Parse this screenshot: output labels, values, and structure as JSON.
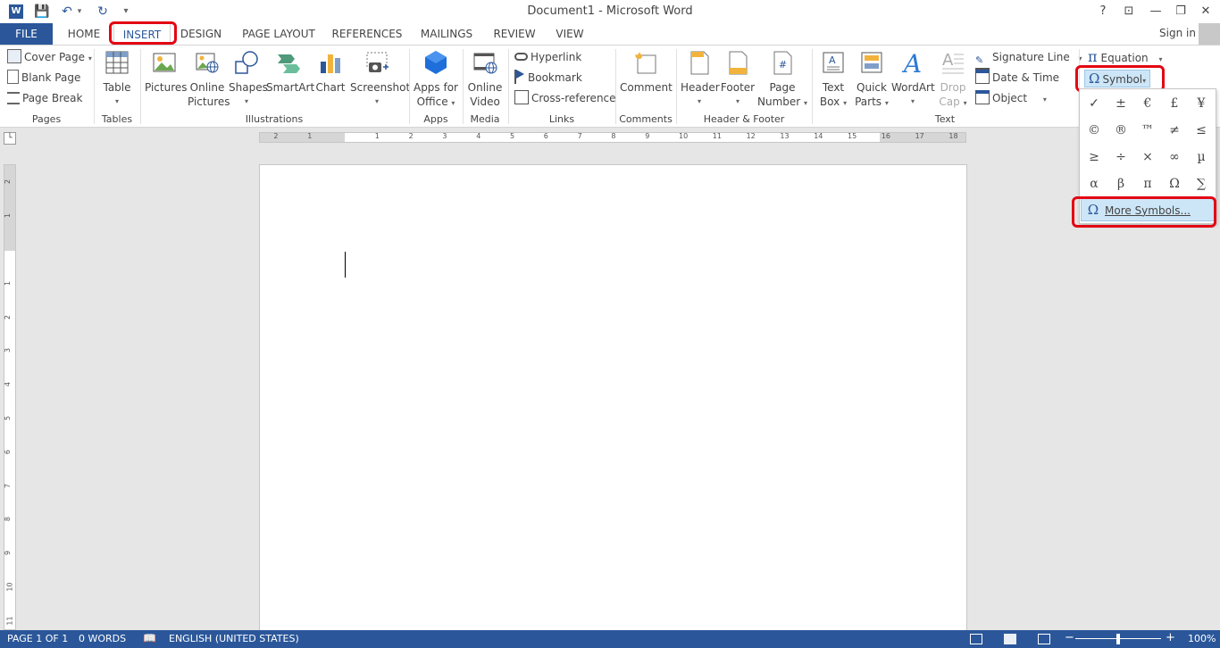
{
  "app": {
    "title": "Document1 - Microsoft Word",
    "icon_letter": "W",
    "accent": "#2b579a",
    "highlight": "#e30613"
  },
  "window_controls": {
    "help": "?",
    "ribbon_options": "⊡",
    "minimize": "—",
    "restore": "❐",
    "close": "✕"
  },
  "quick_access": {
    "save_icon": "💾",
    "undo_icon": "↶",
    "undo_dropdown": "▾",
    "redo_icon": "↻",
    "customize_icon": "▾"
  },
  "tabs": {
    "file": "FILE",
    "items": [
      "HOME",
      "INSERT",
      "DESIGN",
      "PAGE LAYOUT",
      "REFERENCES",
      "MAILINGS",
      "REVIEW",
      "VIEW"
    ],
    "active": "INSERT"
  },
  "account": {
    "sign_in": "Sign in"
  },
  "ribbon": {
    "pages": {
      "label": "Pages",
      "cover_page": "Cover Page",
      "blank_page": "Blank Page",
      "page_break": "Page Break"
    },
    "tables": {
      "label": "Tables",
      "table": "Table"
    },
    "illustrations": {
      "label": "Illustrations",
      "pictures": "Pictures",
      "online_pictures_1": "Online",
      "online_pictures_2": "Pictures",
      "shapes": "Shapes",
      "smartart": "SmartArt",
      "chart": "Chart",
      "screenshot": "Screenshot"
    },
    "apps": {
      "label": "Apps",
      "apps_for_office_1": "Apps for",
      "apps_for_office_2": "Office"
    },
    "media": {
      "label": "Media",
      "online_video_1": "Online",
      "online_video_2": "Video"
    },
    "links": {
      "label": "Links",
      "hyperlink": "Hyperlink",
      "bookmark": "Bookmark",
      "cross_reference": "Cross-reference"
    },
    "comments": {
      "label": "Comments",
      "comment": "Comment"
    },
    "header_footer": {
      "label": "Header & Footer",
      "header": "Header",
      "footer": "Footer",
      "page_number_1": "Page",
      "page_number_2": "Number"
    },
    "text": {
      "label": "Text",
      "text_box_1": "Text",
      "text_box_2": "Box",
      "quick_parts_1": "Quick",
      "quick_parts_2": "Parts",
      "wordart": "WordArt",
      "drop_cap_1": "Drop",
      "drop_cap_2": "Cap",
      "signature_line": "Signature Line",
      "date_time": "Date & Time",
      "object": "Object"
    },
    "symbols": {
      "equation": "Equation",
      "symbol": "Symbol"
    }
  },
  "symbol_menu": {
    "symbols": [
      "✓",
      "±",
      "€",
      "£",
      "¥",
      "©",
      "®",
      "™",
      "≠",
      "≤",
      "≥",
      "÷",
      "×",
      "∞",
      "µ",
      "α",
      "β",
      "π",
      "Ω",
      "∑"
    ],
    "more_symbols": "More Symbols..."
  },
  "ruler": {
    "h_labels": [
      "2",
      "1",
      "1",
      "2",
      "3",
      "4",
      "5",
      "6",
      "7",
      "8",
      "9",
      "10",
      "11",
      "12",
      "13",
      "14",
      "15",
      "16",
      "17",
      "18"
    ],
    "v_labels": [
      "2",
      "1",
      "1",
      "2",
      "3",
      "4",
      "5",
      "6",
      "7",
      "8",
      "9",
      "10",
      "11"
    ]
  },
  "status": {
    "page": "PAGE 1 OF 1",
    "words": "0 WORDS",
    "language": "ENGLISH (UNITED STATES)",
    "zoom": "100%"
  }
}
